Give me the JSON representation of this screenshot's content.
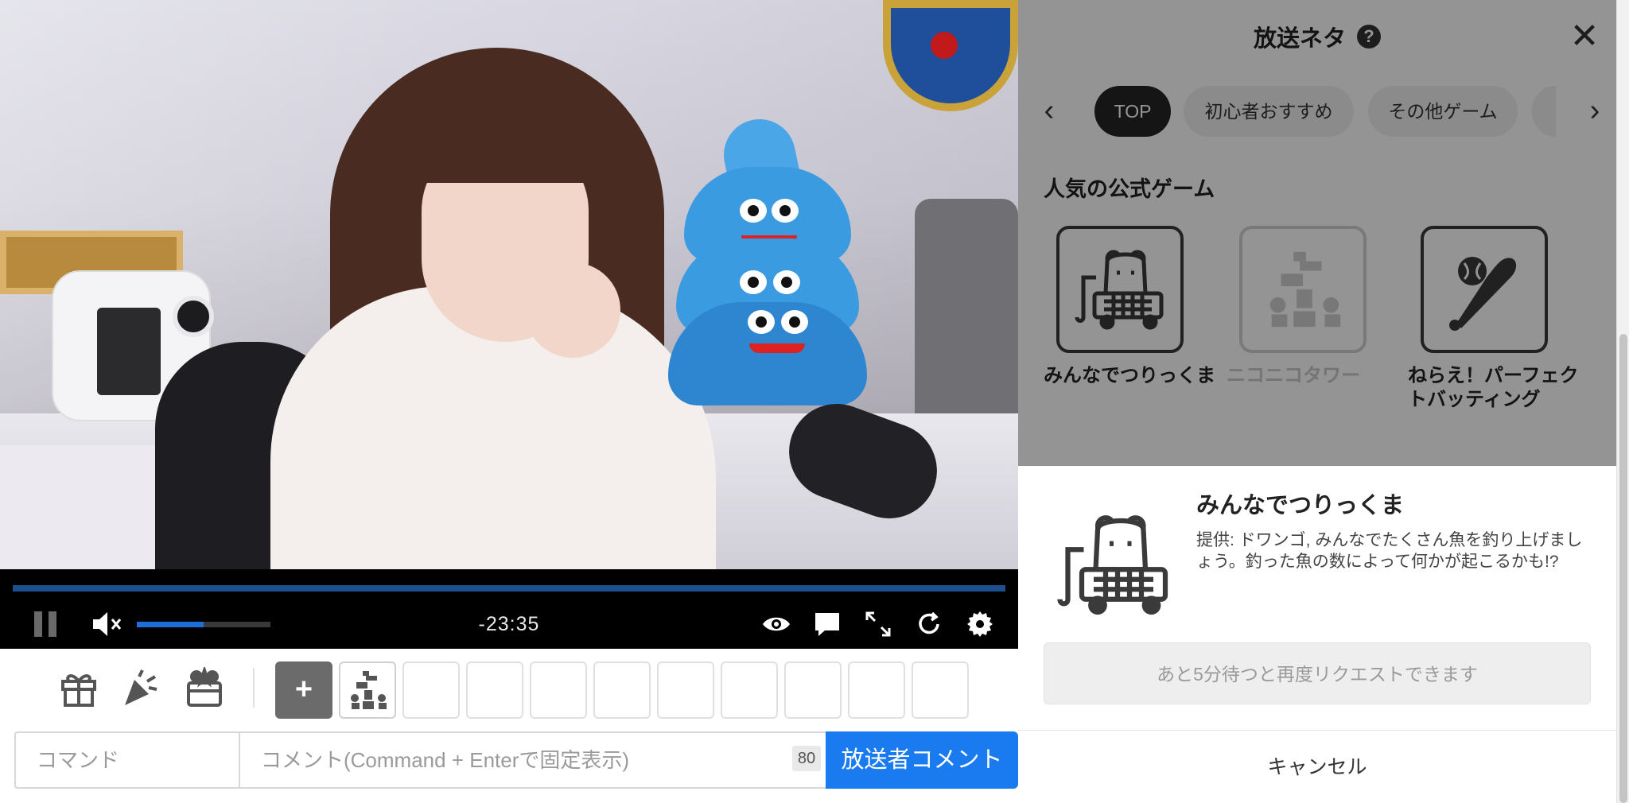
{
  "player": {
    "time_remaining": "-23:35",
    "volume_fraction": 0.5,
    "seek_fraction": 1.0
  },
  "toolbar": {
    "add_label": "+"
  },
  "command_bar": {
    "command_placeholder": "コマンド",
    "comment_placeholder": "コメント(Command + Enterで固定表示)",
    "char_count": "80",
    "submit_label": "放送者コメント"
  },
  "panel": {
    "title": "放送ネタ",
    "help_glyph": "?",
    "close_glyph": "✕",
    "tabs": [
      {
        "label": "TOP",
        "active": true
      },
      {
        "label": "初心者おすすめ",
        "active": false
      },
      {
        "label": "その他ゲーム",
        "active": false
      }
    ],
    "prev_glyph": "‹",
    "next_glyph": "›",
    "section_title": "人気の公式ゲーム",
    "games": [
      {
        "label": "みんなでつりっくま",
        "icon": "bear-fishing-truck-icon",
        "disabled": false
      },
      {
        "label": "ニコニコタワー",
        "icon": "tower-blocks-icon",
        "disabled": true
      },
      {
        "label": "ねらえ！パーフェクトバッティング",
        "icon": "baseball-bat-icon",
        "disabled": false
      }
    ]
  },
  "detail": {
    "title": "みんなでつりっくま",
    "description": "提供: ドワンゴ, みんなでたくさん魚を釣り上げましょう。釣った魚の数によって何かが起こるかも!?",
    "wait_label": "あと5分待つと再度リクエストできます",
    "cancel_label": "キャンセル"
  },
  "colors": {
    "accent": "#1a7bf0",
    "seek": "#1d4e8f",
    "tab_active": "#252525",
    "overlay": "rgba(0,0,0,0.42)"
  }
}
